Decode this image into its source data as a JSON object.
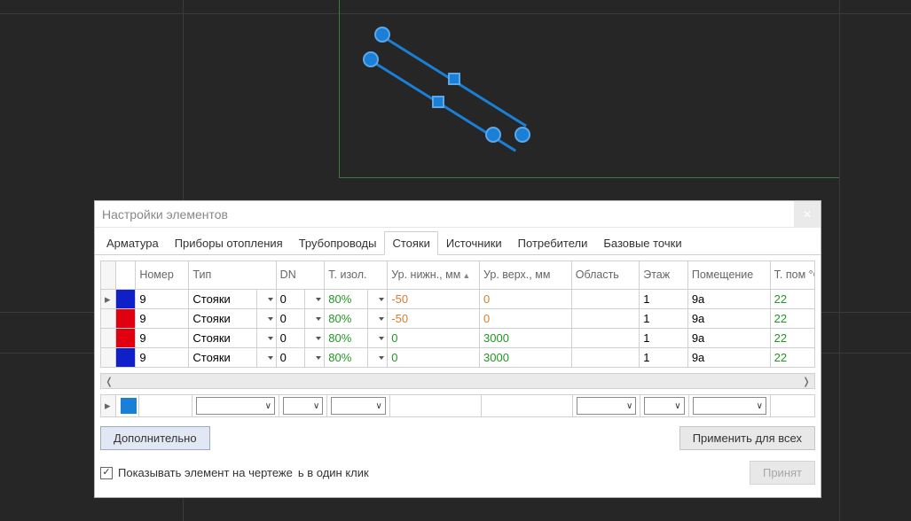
{
  "dialog": {
    "title": "Настройки элементов",
    "tabs": [
      "Арматура",
      "Приборы отопления",
      "Трубопроводы",
      "Стояки",
      "Источники",
      "Потребители",
      "Базовые точки"
    ],
    "active_tab_index": 3
  },
  "columns": {
    "nomer": "Номер",
    "tip": "Тип",
    "dn": "DN",
    "izol": "Т. изол.",
    "ur_nizh": "Ур. нижн., мм",
    "ur_verh": "Ур. верх., мм",
    "oblast": "Область",
    "etazh": "Этаж",
    "pomesh": "Помещение",
    "t_pom": "Т. пом °C"
  },
  "rows": [
    {
      "color": "#1020c8",
      "nomer": "9",
      "tip": "Стояки",
      "dn": "0",
      "izol": "80%",
      "ur_nizh": "-50",
      "ur_verh": "0",
      "oblast": "",
      "etazh": "1",
      "pomesh": "9a",
      "t_pom": "22"
    },
    {
      "color": "#e00010",
      "nomer": "9",
      "tip": "Стояки",
      "dn": "0",
      "izol": "80%",
      "ur_nizh": "-50",
      "ur_verh": "0",
      "oblast": "",
      "etazh": "1",
      "pomesh": "9a",
      "t_pom": "22"
    },
    {
      "color": "#e00010",
      "nomer": "9",
      "tip": "Стояки",
      "dn": "0",
      "izol": "80%",
      "ur_nizh": "0",
      "ur_verh": "3000",
      "oblast": "",
      "etazh": "1",
      "pomesh": "9a",
      "t_pom": "22"
    },
    {
      "color": "#1020c8",
      "nomer": "9",
      "tip": "Стояки",
      "dn": "0",
      "izol": "80%",
      "ur_nizh": "0",
      "ur_verh": "3000",
      "oblast": "",
      "etazh": "1",
      "pomesh": "9a",
      "t_pom": "22"
    }
  ],
  "footer": {
    "more_btn": "Дополнительно",
    "apply_all_btn": "Применить для всех",
    "accept_btn": "Принят",
    "checkbox_label": "Показывать элемент на чертеже",
    "one_click_label": "ь в один клик"
  },
  "colors": {
    "blue": "#1020c8",
    "red": "#e00010",
    "node": "#1a7fd6"
  }
}
